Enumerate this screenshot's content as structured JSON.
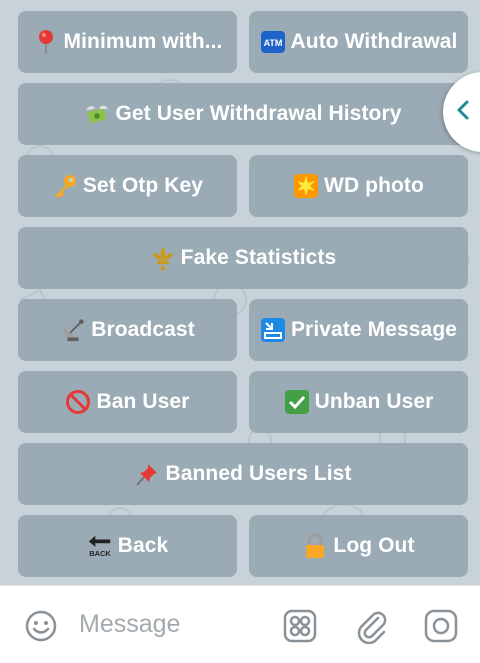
{
  "keyboard": {
    "buttons": [
      {
        "id": "minimum-withdrawal",
        "emoji": "round-pushpin-icon",
        "label": "Minimum with..."
      },
      {
        "id": "auto-withdrawal",
        "emoji": "atm-icon",
        "label": "Auto Withdrawal"
      },
      {
        "id": "withdrawal-history",
        "emoji": "money-with-wings-icon",
        "label": "Get User Withdrawal History"
      },
      {
        "id": "set-otp-key",
        "emoji": "key-icon",
        "label": "Set Otp Key"
      },
      {
        "id": "wd-photo",
        "emoji": "eight-pointed-star-icon",
        "label": "WD photo"
      },
      {
        "id": "fake-statistics",
        "emoji": "fleur-de-lis-icon",
        "label": "Fake Statisticts"
      },
      {
        "id": "broadcast",
        "emoji": "satellite-antenna-icon",
        "label": "Broadcast"
      },
      {
        "id": "private-message",
        "emoji": "inbox-arrow-icon",
        "label": "Private Message"
      },
      {
        "id": "ban-user",
        "emoji": "prohibited-icon",
        "label": "Ban User"
      },
      {
        "id": "unban-user",
        "emoji": "check-mark-button-icon",
        "label": "Unban User"
      },
      {
        "id": "banned-users-list",
        "emoji": "pushpin-icon",
        "label": "Banned Users List"
      },
      {
        "id": "back",
        "emoji": "back-arrow-icon",
        "label": "Back"
      },
      {
        "id": "log-out",
        "emoji": "locked-icon",
        "label": "Log Out"
      }
    ]
  },
  "side_tab": {
    "icon": "chevron-left-icon"
  },
  "input_bar": {
    "placeholder": "Message",
    "icons": [
      "emoji-icon",
      "bot-keyboard-icon",
      "attach-icon",
      "camera-icon"
    ]
  },
  "colors": {
    "button_bg": "#8ea0aa",
    "accent": "#1e8a96",
    "chat_bg": "#c7d3d8"
  }
}
